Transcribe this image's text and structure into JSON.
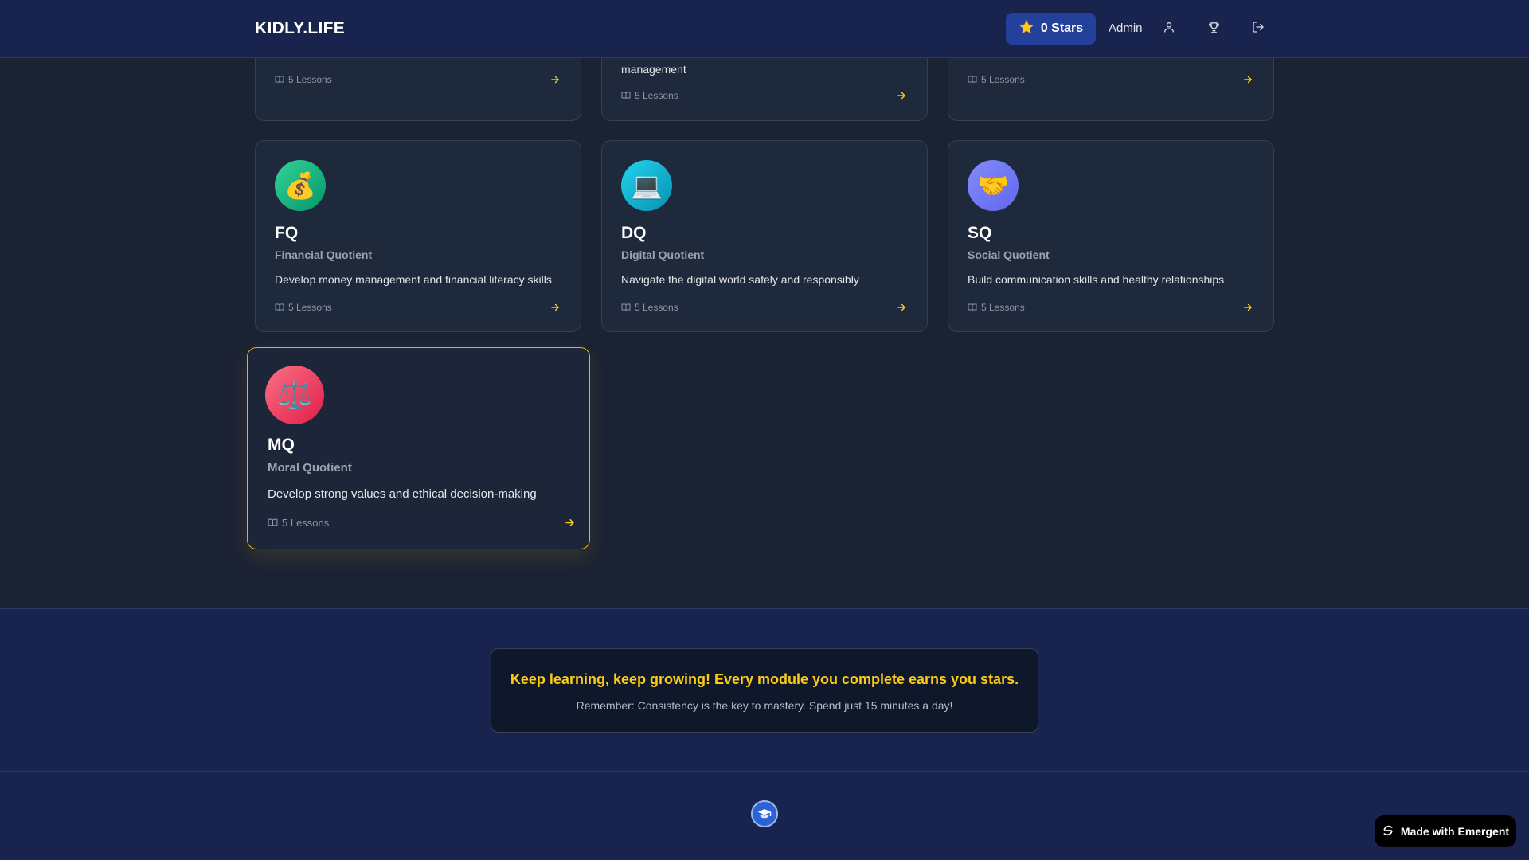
{
  "header": {
    "brand": "KIDLY.LIFE",
    "stars_label": "0 Stars",
    "user_label": "Admin"
  },
  "modules_partial": [
    {
      "lessons": "5 Lessons"
    },
    {
      "desc_tail": "management",
      "lessons": "5 Lessons"
    },
    {
      "lessons": "5 Lessons"
    }
  ],
  "modules": [
    {
      "emoji": "💰",
      "code": "FQ",
      "name": "Financial Quotient",
      "description": "Develop money management and financial literacy skills",
      "lessons": "5 Lessons",
      "color_from": "#34d399",
      "color_to": "#059669"
    },
    {
      "emoji": "💻",
      "code": "DQ",
      "name": "Digital Quotient",
      "description": "Navigate the digital world safely and responsibly",
      "lessons": "5 Lessons",
      "color_from": "#22d3ee",
      "color_to": "#0891b2"
    },
    {
      "emoji": "🤝",
      "code": "SQ",
      "name": "Social Quotient",
      "description": "Build communication skills and healthy relationships",
      "lessons": "5 Lessons",
      "color_from": "#818cf8",
      "color_to": "#6366f1"
    },
    {
      "emoji": "⚖️",
      "code": "MQ",
      "name": "Moral Quotient",
      "description": "Develop strong values and ethical decision-making",
      "lessons": "5 Lessons",
      "color_from": "#fb7185",
      "color_to": "#e11d48"
    }
  ],
  "motivation": {
    "title": "Keep learning, keep growing! Every module you complete earns you stars.",
    "subtitle": "Remember: Consistency is the key to mastery. Spend just 15 minutes a day!"
  },
  "badge": {
    "label": "Made with Emergent"
  },
  "colors": {
    "accent": "#facc15",
    "header_bg": "#18244e",
    "page_bg": "#1a2234",
    "card_bg": "#1e293b"
  }
}
